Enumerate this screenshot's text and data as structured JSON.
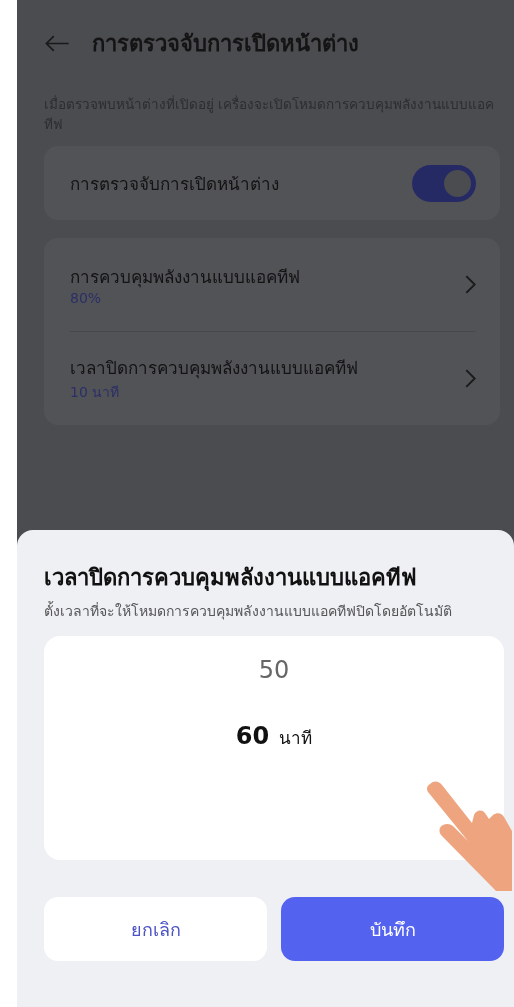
{
  "header": {
    "title": "การตรวจจับการเปิดหน้าต่าง"
  },
  "description": "เมื่อตรวจพบหน้าต่างที่เปิดอยู่ เครื่องจะเปิดโหมดการควบคุมพลังงานแบบแอคทีฟ",
  "toggle_row": {
    "label": "การตรวจจับการเปิดหน้าต่าง",
    "on": true
  },
  "settings": [
    {
      "label": "การควบคุมพลังงานแบบแอคทีฟ",
      "value": "80%"
    },
    {
      "label": "เวลาปิดการควบคุมพลังงานแบบแอคทีฟ",
      "value": "10 นาที"
    }
  ],
  "sheet": {
    "title": "เวลาปิดการควบคุมพลังงานแบบแอคทีฟ",
    "subtitle": "ตั้งเวลาที่จะให้โหมดการควบคุมพลังงานแบบแอคทีฟปิดโดยอัตโนมัติ",
    "picker": [
      {
        "value": "50",
        "selected": false
      },
      {
        "value": "60",
        "unit": "นาที",
        "selected": true
      }
    ],
    "buttons": [
      {
        "label": "ยกเลิก",
        "kind": "secondary"
      },
      {
        "label": "บันทึก",
        "kind": "primary"
      }
    ]
  }
}
